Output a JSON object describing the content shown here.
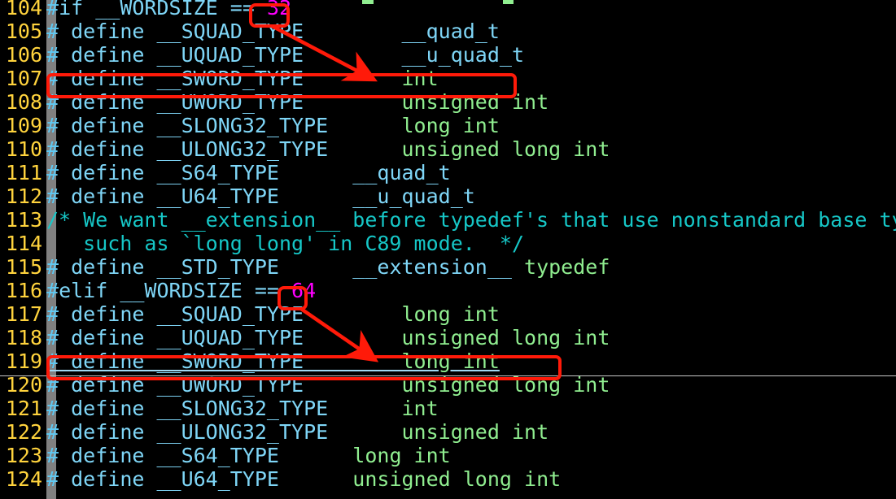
{
  "editor": {
    "app": "vim-code-viewer",
    "background_color": "#000000",
    "fold_column_color": "#808080",
    "line_number_color": "#ffd33d",
    "identifier_color": "#7fd6f7",
    "preproc_color": "#5fc9f3",
    "type_color": "#90ee90",
    "comment_color": "#16c7c7",
    "number_color": "#ff00ff",
    "annotation_color": "#ff1a09",
    "cursor_rule_color": "#c8c8c8",
    "cursor_line_number": "119"
  },
  "lines": [
    {
      "num": "104",
      "text": "#if __WORDSIZE == 32",
      "tokens": [
        {
          "t": "#",
          "c": "hash"
        },
        {
          "t": "if __WORDSIZE == ",
          "c": "ident"
        },
        {
          "t": "32",
          "c": "num"
        }
      ]
    },
    {
      "num": "105",
      "text": "# define __SQUAD_TYPE        __quad_t",
      "tokens": [
        {
          "t": "#",
          "c": "hash"
        },
        {
          "t": " define __SQUAD_TYPE        __quad_t",
          "c": "ident"
        }
      ]
    },
    {
      "num": "106",
      "text": "# define __UQUAD_TYPE        __u_quad_t",
      "tokens": [
        {
          "t": "#",
          "c": "hash"
        },
        {
          "t": " define __UQUAD_TYPE        __u_quad_t",
          "c": "ident"
        }
      ]
    },
    {
      "num": "107",
      "text": "# define __SWORD_TYPE        int",
      "tokens": [
        {
          "t": "#",
          "c": "hash"
        },
        {
          "t": " define __SWORD_TYPE        ",
          "c": "ident"
        },
        {
          "t": "int",
          "c": "type"
        }
      ]
    },
    {
      "num": "108",
      "text": "# define __UWORD_TYPE        unsigned int",
      "tokens": [
        {
          "t": "#",
          "c": "hash"
        },
        {
          "t": " define __UWORD_TYPE        ",
          "c": "ident"
        },
        {
          "t": "unsigned int",
          "c": "type"
        }
      ]
    },
    {
      "num": "109",
      "text": "# define __SLONG32_TYPE      long int",
      "tokens": [
        {
          "t": "#",
          "c": "hash"
        },
        {
          "t": " define __SLONG32_TYPE      ",
          "c": "ident"
        },
        {
          "t": "long int",
          "c": "type"
        }
      ]
    },
    {
      "num": "110",
      "text": "# define __ULONG32_TYPE      unsigned long int",
      "tokens": [
        {
          "t": "#",
          "c": "hash"
        },
        {
          "t": " define __ULONG32_TYPE      ",
          "c": "ident"
        },
        {
          "t": "unsigned long int",
          "c": "type"
        }
      ]
    },
    {
      "num": "111",
      "text": "# define __S64_TYPE      __quad_t",
      "tokens": [
        {
          "t": "#",
          "c": "hash"
        },
        {
          "t": " define __S64_TYPE      __quad_t",
          "c": "ident"
        }
      ]
    },
    {
      "num": "112",
      "text": "# define __U64_TYPE      __u_quad_t",
      "tokens": [
        {
          "t": "#",
          "c": "hash"
        },
        {
          "t": " define __U64_TYPE      __u_quad_t",
          "c": "ident"
        }
      ]
    },
    {
      "num": "113",
      "text": "/* We want __extension__ before typedef's that use nonstandard base types",
      "tokens": [
        {
          "t": "/* We want __extension__ before typedef's that use nonstandard base types",
          "c": "comment"
        }
      ]
    },
    {
      "num": "114",
      "text": "   such as `long long' in C89 mode.  */",
      "tokens": [
        {
          "t": "   such as `long long' in C89 mode.  */",
          "c": "comment"
        }
      ]
    },
    {
      "num": "115",
      "text": "# define __STD_TYPE      __extension__ typedef",
      "tokens": [
        {
          "t": "#",
          "c": "hash"
        },
        {
          "t": " define __STD_TYPE      __extension__ ",
          "c": "ident"
        },
        {
          "t": "typedef",
          "c": "type"
        }
      ]
    },
    {
      "num": "116",
      "text": "#elif __WORDSIZE == 64",
      "tokens": [
        {
          "t": "#",
          "c": "hash"
        },
        {
          "t": "elif __WORDSIZE == ",
          "c": "ident"
        },
        {
          "t": "64",
          "c": "num"
        }
      ]
    },
    {
      "num": "117",
      "text": "# define __SQUAD_TYPE        long int",
      "tokens": [
        {
          "t": "#",
          "c": "hash"
        },
        {
          "t": " define __SQUAD_TYPE        ",
          "c": "ident"
        },
        {
          "t": "long int",
          "c": "type"
        }
      ]
    },
    {
      "num": "118",
      "text": "# define __UQUAD_TYPE        unsigned long int",
      "tokens": [
        {
          "t": "#",
          "c": "hash"
        },
        {
          "t": " define __UQUAD_TYPE        ",
          "c": "ident"
        },
        {
          "t": "unsigned long int",
          "c": "type"
        }
      ]
    },
    {
      "num": "119",
      "text": "# define __SWORD_TYPE        long int",
      "tokens": [
        {
          "t": "#",
          "c": "hash"
        },
        {
          "t": " define __SWORD_TYPE        ",
          "c": "ident"
        },
        {
          "t": "long int",
          "c": "type"
        }
      ]
    },
    {
      "num": "120",
      "text": "# define __UWORD_TYPE        unsigned long int",
      "tokens": [
        {
          "t": "#",
          "c": "hash"
        },
        {
          "t": " define __UWORD_TYPE        ",
          "c": "ident"
        },
        {
          "t": "unsigned long int",
          "c": "type"
        }
      ]
    },
    {
      "num": "121",
      "text": "# define __SLONG32_TYPE      int",
      "tokens": [
        {
          "t": "#",
          "c": "hash"
        },
        {
          "t": " define __SLONG32_TYPE      ",
          "c": "ident"
        },
        {
          "t": "int",
          "c": "type"
        }
      ]
    },
    {
      "num": "122",
      "text": "# define __ULONG32_TYPE      unsigned int",
      "tokens": [
        {
          "t": "#",
          "c": "hash"
        },
        {
          "t": " define __ULONG32_TYPE      ",
          "c": "ident"
        },
        {
          "t": "unsigned int",
          "c": "type"
        }
      ]
    },
    {
      "num": "123",
      "text": "# define __S64_TYPE      long int",
      "tokens": [
        {
          "t": "#",
          "c": "hash"
        },
        {
          "t": " define __S64_TYPE      ",
          "c": "ident"
        },
        {
          "t": "long int",
          "c": "type"
        }
      ]
    },
    {
      "num": "124",
      "text": "# define __U64_TYPE      unsigned long int",
      "tokens": [
        {
          "t": "#",
          "c": "hash"
        },
        {
          "t": " define __U64_TYPE      ",
          "c": "ident"
        },
        {
          "t": "unsigned long int",
          "c": "type"
        }
      ]
    }
  ],
  "annotations": [
    {
      "name": "highlight-pill-wordsize-32",
      "kind": "pill",
      "target_text": "32",
      "target_line": "104"
    },
    {
      "name": "highlight-box-sword-type-32bit",
      "kind": "box",
      "target_text": "# define __SWORD_TYPE        int",
      "target_line": "107"
    },
    {
      "name": "arrow-32-to-sword-type",
      "kind": "arrow",
      "from": "32",
      "to": "# define __SWORD_TYPE        int"
    },
    {
      "name": "highlight-pill-wordsize-64",
      "kind": "pill",
      "target_text": "64",
      "target_line": "116"
    },
    {
      "name": "highlight-box-sword-type-64bit",
      "kind": "box",
      "target_text": "# define __SWORD_TYPE        long int",
      "target_line": "119"
    },
    {
      "name": "arrow-64-to-sword-type",
      "kind": "arrow",
      "from": "64",
      "to": "# define __SWORD_TYPE        long int"
    }
  ]
}
